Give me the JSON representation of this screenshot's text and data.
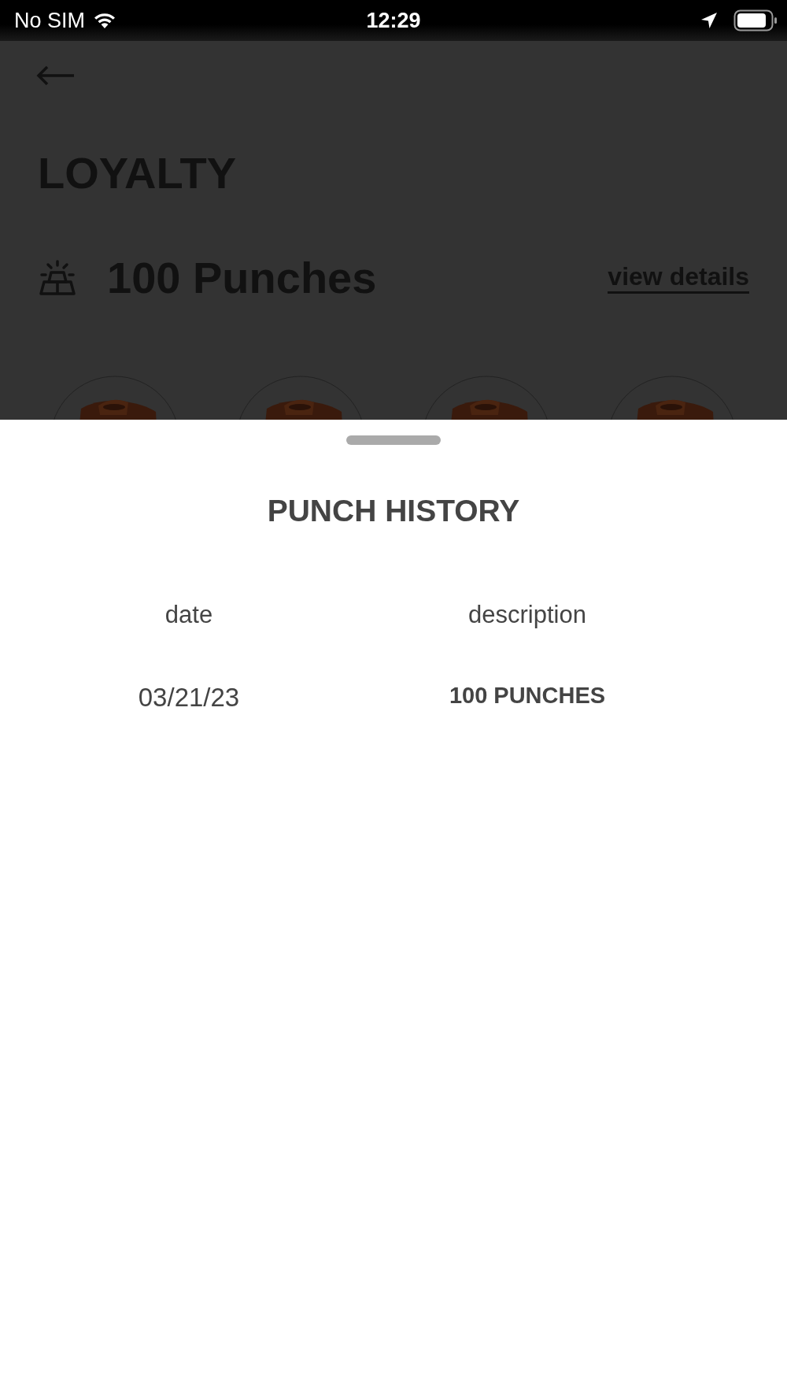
{
  "status_bar": {
    "carrier": "No SIM",
    "time": "12:29"
  },
  "page": {
    "title": "LOYALTY",
    "points": "100 Punches",
    "details_link": "view details"
  },
  "sheet": {
    "title": "PUNCH HISTORY",
    "columns": [
      "date",
      "description"
    ],
    "rows": [
      {
        "date": "03/21/23",
        "description": "100 PUNCHES"
      }
    ]
  }
}
